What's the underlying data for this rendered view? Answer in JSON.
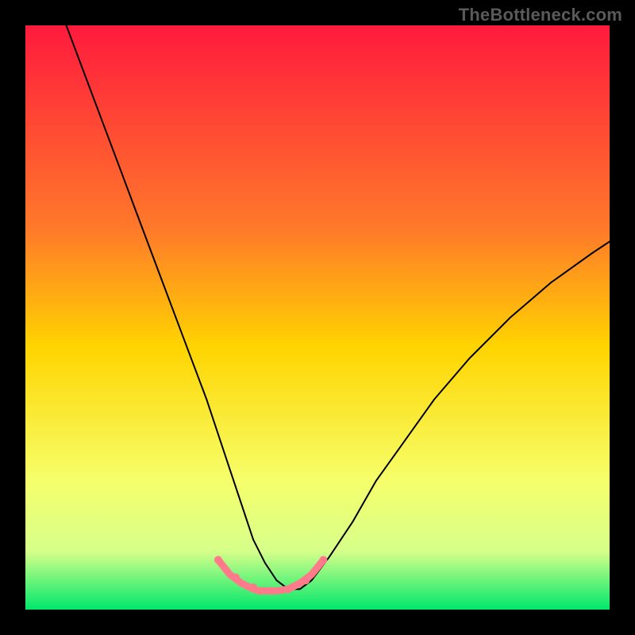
{
  "watermark": "TheBottleneck.com",
  "chart_data": {
    "type": "line",
    "title": "",
    "xlabel": "",
    "ylabel": "",
    "xlim": [
      0,
      100
    ],
    "ylim": [
      0,
      100
    ],
    "grid": false,
    "legend": false,
    "annotations": [],
    "background_gradient_stops": [
      {
        "offset": 0,
        "color": "#ff1a3d"
      },
      {
        "offset": 35,
        "color": "#ff7a2a"
      },
      {
        "offset": 55,
        "color": "#ffd400"
      },
      {
        "offset": 78,
        "color": "#f6ff6b"
      },
      {
        "offset": 90,
        "color": "#d6ff8a"
      },
      {
        "offset": 100,
        "color": "#00e86b"
      }
    ],
    "series": [
      {
        "name": "black-curve",
        "color": "#000000",
        "width": 2,
        "x": [
          7,
          10,
          13,
          16,
          19,
          22,
          25,
          28,
          31,
          33,
          35,
          37,
          39,
          41,
          43,
          45,
          47,
          49,
          52,
          56,
          60,
          65,
          70,
          76,
          83,
          90,
          97,
          100
        ],
        "y": [
          100,
          92,
          84,
          76,
          68,
          60,
          52,
          44,
          36,
          30,
          24,
          18,
          12,
          8,
          5,
          3.5,
          3.5,
          5,
          9,
          15,
          22,
          29,
          36,
          43,
          50,
          56,
          61,
          63
        ]
      },
      {
        "name": "pink-valley",
        "color": "#ff7a8a",
        "width": 9,
        "x": [
          33,
          35,
          37,
          39,
          40,
          41,
          42,
          43,
          45,
          47,
          49,
          51
        ],
        "y": [
          8.5,
          6,
          4.5,
          3.5,
          3.2,
          3.2,
          3.2,
          3.2,
          3.5,
          4.5,
          6,
          8.5
        ]
      }
    ],
    "valley_markers": {
      "color": "#ff7a8a",
      "radius": 5,
      "points": [
        {
          "x": 33,
          "y": 8.5
        },
        {
          "x": 36,
          "y": 5.5
        },
        {
          "x": 39,
          "y": 3.8
        },
        {
          "x": 42,
          "y": 3.2
        },
        {
          "x": 45,
          "y": 3.5
        },
        {
          "x": 48,
          "y": 5.0
        },
        {
          "x": 51,
          "y": 8.5
        }
      ]
    }
  }
}
